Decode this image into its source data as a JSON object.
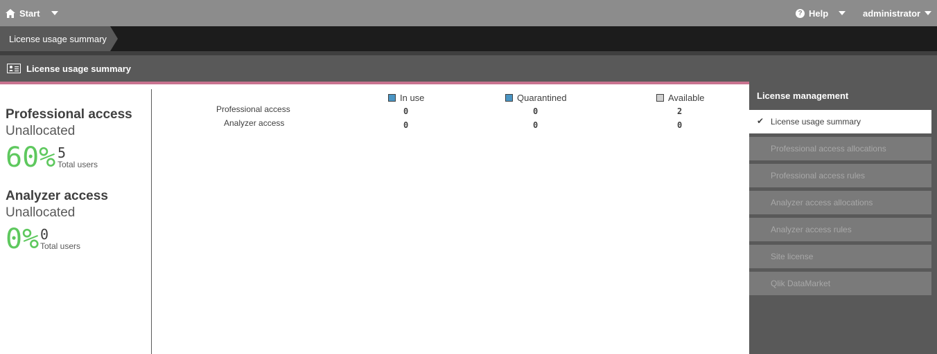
{
  "topbar": {
    "start_label": "Start",
    "help_label": "Help",
    "user_label": "administrator"
  },
  "breadcrumb": {
    "current": "License usage summary"
  },
  "section": {
    "title": "License usage summary"
  },
  "summary": [
    {
      "title": "Professional access",
      "subtitle": "Unallocated",
      "percent": "60%",
      "total_users": "5",
      "total_users_label": "Total users"
    },
    {
      "title": "Analyzer access",
      "subtitle": "Unallocated",
      "percent": "0%",
      "total_users": "0",
      "total_users_label": "Total users"
    }
  ],
  "table": {
    "legend": [
      {
        "label": "In use",
        "color": "#4a95c4"
      },
      {
        "label": "Quarantined",
        "color": "#4a95c4"
      },
      {
        "label": "Available",
        "color": "#d0d0d0"
      }
    ],
    "rows": [
      {
        "label": "Professional access",
        "in_use": "0",
        "quarantined": "0",
        "available": "2"
      },
      {
        "label": "Analyzer access",
        "in_use": "0",
        "quarantined": "0",
        "available": "0"
      }
    ]
  },
  "sidebar": {
    "title": "License management",
    "items": [
      {
        "label": "License usage summary",
        "active": true
      },
      {
        "label": "Professional access allocations",
        "active": false
      },
      {
        "label": "Professional access rules",
        "active": false
      },
      {
        "label": "Analyzer access allocations",
        "active": false
      },
      {
        "label": "Analyzer access rules",
        "active": false
      },
      {
        "label": "Site license",
        "active": false
      },
      {
        "label": "Qlik DataMarket",
        "active": false
      }
    ]
  }
}
